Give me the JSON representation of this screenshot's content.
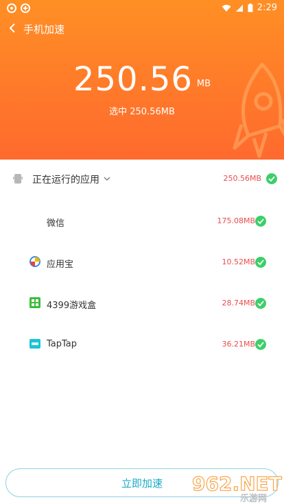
{
  "status": {
    "time": "2:29"
  },
  "header": {
    "title": "手机加速"
  },
  "summary": {
    "amount": "250.56",
    "unit": "MB",
    "selected": "选中 250.56MB"
  },
  "group": {
    "label": "正在运行的应用",
    "size": "250.56MB"
  },
  "apps": [
    {
      "name": "微信",
      "size": "175.08MB",
      "icon": "wechat-icon"
    },
    {
      "name": "应用宝",
      "size": "10.52MB",
      "icon": "yingyongbao-icon"
    },
    {
      "name": "4399游戏盒",
      "size": "28.74MB",
      "icon": "4399-icon"
    },
    {
      "name": "TapTap",
      "size": "36.21MB",
      "icon": "taptap-icon"
    }
  ],
  "action": {
    "label": "立即加速"
  },
  "watermark": {
    "text": "962.NET",
    "sub": "乐游网"
  },
  "colors": {
    "accent": "#ff7a2a",
    "check": "#3ccf6a",
    "size": "#e94c4c",
    "button": "#1aa9c8"
  }
}
